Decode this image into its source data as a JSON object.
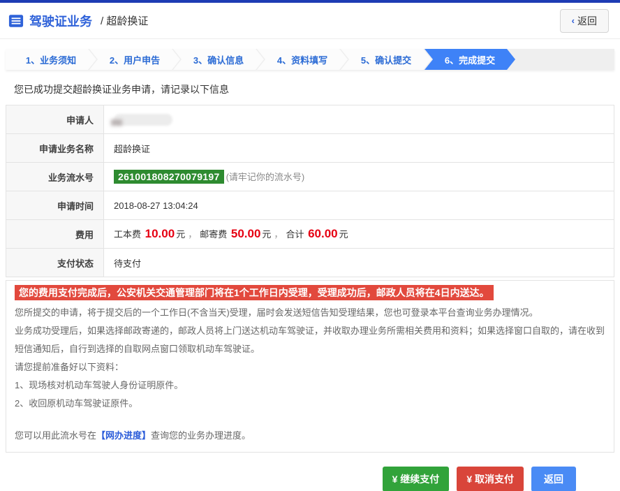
{
  "header": {
    "title": "驾驶证业务",
    "subtitle": "/ 超龄换证",
    "back_chevron": "‹",
    "back_label": "返回"
  },
  "steps": [
    {
      "label": "1、业务须知",
      "active": false
    },
    {
      "label": "2、用户申告",
      "active": false
    },
    {
      "label": "3、确认信息",
      "active": false
    },
    {
      "label": "4、资料填写",
      "active": false
    },
    {
      "label": "5、确认提交",
      "active": false
    },
    {
      "label": "6、完成提交",
      "active": true
    }
  ],
  "success_message": "您已成功提交超龄换证业务申请，请记录以下信息",
  "info_table": {
    "applicant_label": "申请人",
    "applicant_value_redacted": true,
    "service_label": "申请业务名称",
    "service_value": "超龄换证",
    "serial_label": "业务流水号",
    "serial_value": "261001808270079197",
    "serial_note": "(请牢记你的流水号)",
    "time_label": "申请时间",
    "time_value": "2018-08-27 13:04:24",
    "fee_label": "费用",
    "fee": {
      "part1_label": "工本费",
      "part1_amount": "10.00",
      "unit": "元",
      "sep": "，",
      "part2_label": "邮寄费",
      "part2_amount": "50.00",
      "total_label": "合计",
      "total_amount": "60.00"
    },
    "pay_status_label": "支付状态",
    "pay_status_value": "待支付"
  },
  "notice": {
    "banner": "您的费用支付完成后，公安机关交通管理部门将在1个工作日内受理，受理成功后，邮政人员将在4日内送达。",
    "paragraphs": [
      "您所提交的申请，将于提交后的一个工作日(不含当天)受理，届时会发送短信告知受理结果，您也可登录本平台查询业务办理情况。",
      "业务成功受理后，如果选择邮政寄递的，邮政人员将上门送达机动车驾驶证，并收取办理业务所需相关费用和资料；如果选择窗口自取的，请在收到短信通知后，自行到选择的自取网点窗口领取机动车驾驶证。",
      "请您提前准备好以下资料：",
      "1、现场核对机动车驾驶人身份证明原件。",
      "2、收回原机动车驾驶证原件。"
    ],
    "progress_prefix": "您可以用此流水号在",
    "progress_link": "【网办进度】",
    "progress_suffix": "查询您的业务办理进度。"
  },
  "actions": {
    "continue_pay": "¥ 继续支付",
    "cancel_pay": "¥ 取消支付",
    "back": "返回"
  },
  "colors": {
    "topbar_blue": "#1e3cb4",
    "title_blue": "#2f62d9",
    "step_active_blue": "#3e82f7",
    "serial_green": "#2e8b30",
    "price_red": "#e60012",
    "banner_red": "#e2493d",
    "btn_green": "#31a33a",
    "btn_red": "#d9453a",
    "btn_blue": "#4a8bf5"
  }
}
